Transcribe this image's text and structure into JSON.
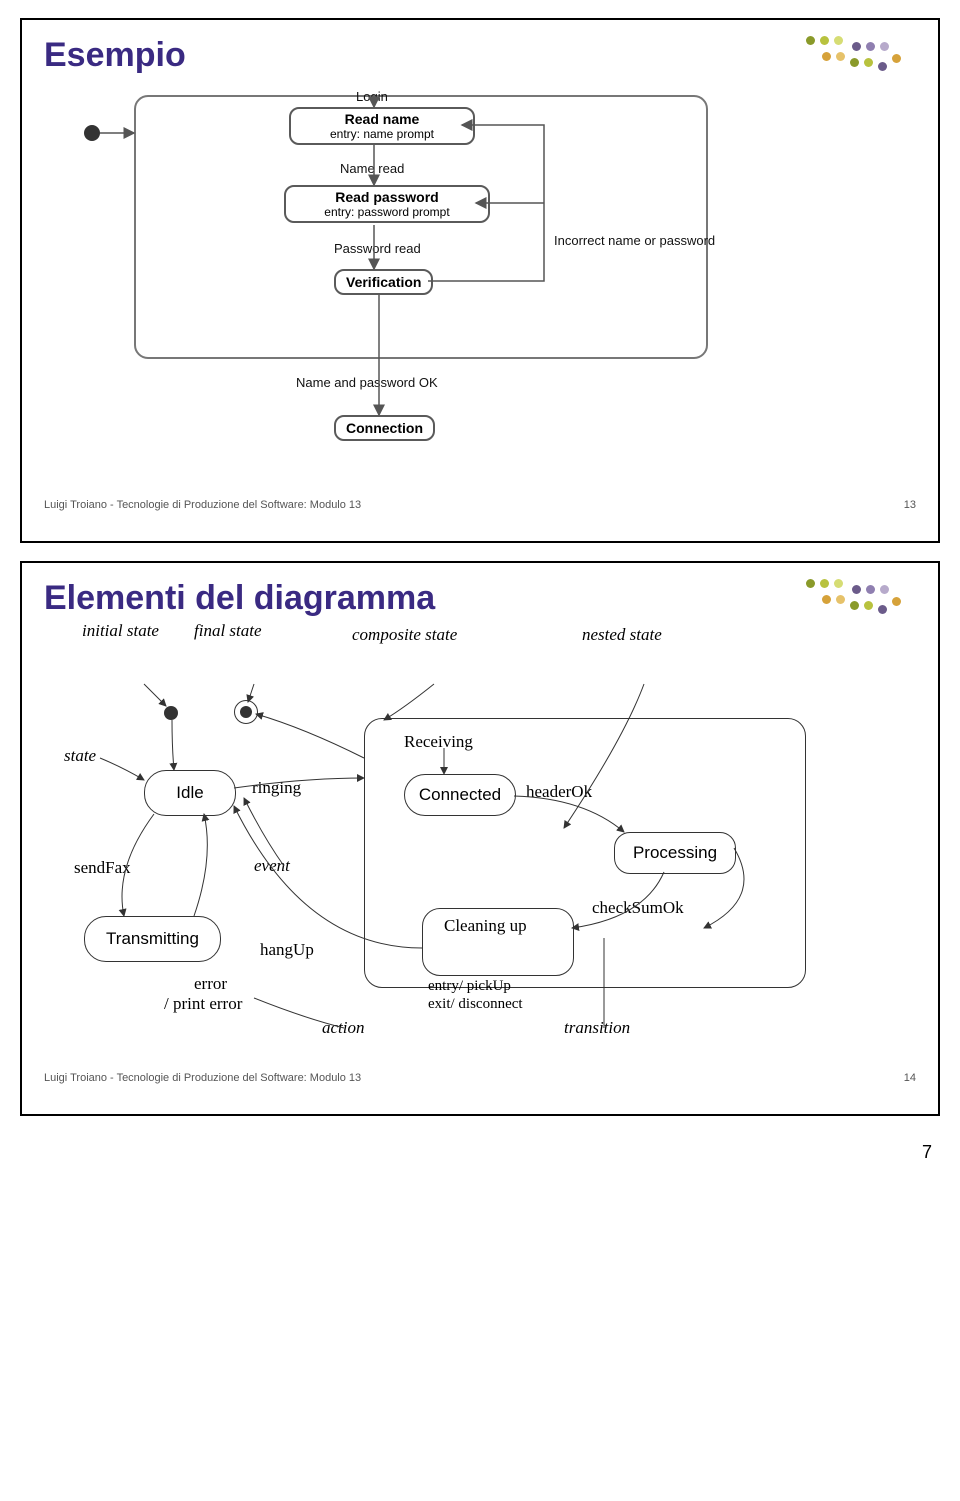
{
  "slide1": {
    "title": "Esempio",
    "login": {
      "trigger_login": "Login",
      "read_name": "Read name",
      "read_name_entry": "entry: name prompt",
      "name_read": "Name read",
      "read_password": "Read password",
      "read_password_entry": "entry: password prompt",
      "password_read": "Password read",
      "verification": "Verification",
      "incorrect": "Incorrect name or password",
      "ok": "Name and password OK",
      "connection": "Connection"
    },
    "footer": "Luigi Troiano - Tecnologie di Produzione del Software: Modulo 13",
    "footer_num": "13"
  },
  "slide2": {
    "title": "Elementi del diagramma",
    "labels": {
      "initial_state": "initial state",
      "final_state": "final state",
      "composite_state": "composite state",
      "nested_state": "nested state",
      "state": "state",
      "event": "event",
      "action": "action",
      "transition": "transition"
    },
    "fax": {
      "idle": "Idle",
      "ringing": "ringing",
      "sendFax": "sendFax",
      "transmitting": "Transmitting",
      "error": "error",
      "print_error": "/ print error",
      "hangUp": "hangUp",
      "receiving": "Receiving",
      "connected": "Connected",
      "headerOk": "headerOk",
      "processing": "Processing",
      "checkSumOk": "checkSumOk",
      "cleaning": "Cleaning up",
      "entry": "entry/ pickUp",
      "exit": "exit/ disconnect"
    },
    "footer": "Luigi Troiano - Tecnologie di Produzione del Software: Modulo 13",
    "footer_num": "14"
  },
  "page_number": "7",
  "decor_colors": [
    "#8a9a2a",
    "#b8c23e",
    "#d6dd74",
    "#6b5b8a",
    "#8f7fb0",
    "#b7aacb",
    "#d6a23a",
    "#e6c26a"
  ]
}
